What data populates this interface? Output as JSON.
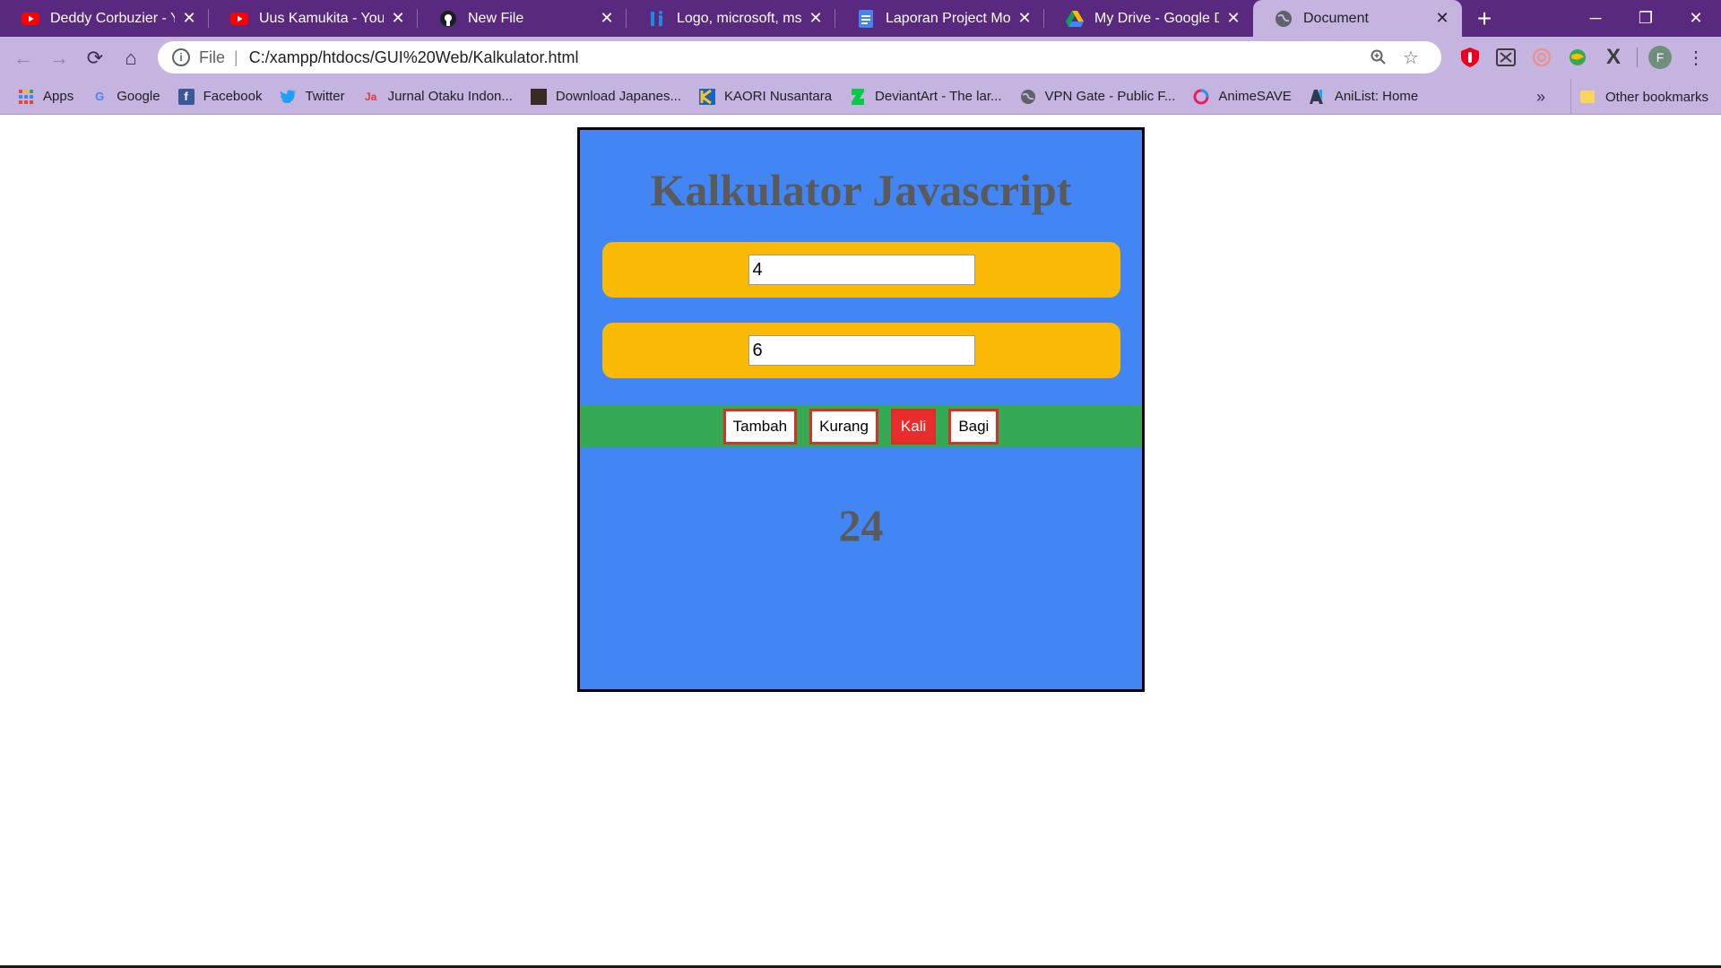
{
  "browser": {
    "tabs": [
      {
        "title": "Deddy Corbuzier - You",
        "icon": "youtube-icon",
        "color": "#ff0000"
      },
      {
        "title": "Uus Kamukita - YouTub",
        "icon": "youtube-icon",
        "color": "#ff0000"
      },
      {
        "title": "New File",
        "icon": "github-icon",
        "color": "#000000"
      },
      {
        "title": "Logo, microsoft, ms, ka",
        "icon": "iconfinder-icon",
        "color": "#1e88e5"
      },
      {
        "title": "Laporan Project MoCa",
        "icon": "google-docs-icon",
        "color": "#4285f4"
      },
      {
        "title": "My Drive - Google Driv",
        "icon": "google-drive-icon",
        "color": "#0f9d58"
      },
      {
        "title": "Document",
        "icon": "globe-icon",
        "color": "#5f6368"
      }
    ],
    "address": {
      "scheme": "File",
      "url": "C:/xampp/htdocs/GUI%20Web/Kalkulator.html"
    },
    "bookmarks": [
      {
        "label": "Apps",
        "icon": "apps-grid-icon"
      },
      {
        "label": "Google",
        "icon": "google-icon"
      },
      {
        "label": "Facebook",
        "icon": "facebook-icon"
      },
      {
        "label": "Twitter",
        "icon": "twitter-icon"
      },
      {
        "label": "Jurnal Otaku Indon...",
        "icon": "jurnal-otaku-icon"
      },
      {
        "label": "Download Japanes...",
        "icon": "download-japanese-icon"
      },
      {
        "label": "KAORI Nusantara",
        "icon": "kaori-icon"
      },
      {
        "label": "DeviantArt - The lar...",
        "icon": "deviantart-icon"
      },
      {
        "label": "VPN Gate - Public F...",
        "icon": "vpn-gate-icon"
      },
      {
        "label": "AnimeSAVE",
        "icon": "animesave-icon"
      },
      {
        "label": "AniList: Home",
        "icon": "anilist-icon"
      }
    ],
    "other_bookmarks": "Other bookmarks",
    "profile_initial": "F"
  },
  "calculator": {
    "title": "Kalkulator Javascript",
    "input1": "4",
    "input2": "6",
    "buttons": {
      "add": "Tambah",
      "subtract": "Kurang",
      "multiply": "Kali",
      "divide": "Bagi"
    },
    "active_operation": "multiply",
    "result": "24"
  },
  "colors": {
    "panel_bg": "#4285f4",
    "input_row_bg": "#f9b904",
    "button_row_bg": "#34a853",
    "button_active": "#ea2c2c",
    "title_text": "#5a5a5a"
  }
}
